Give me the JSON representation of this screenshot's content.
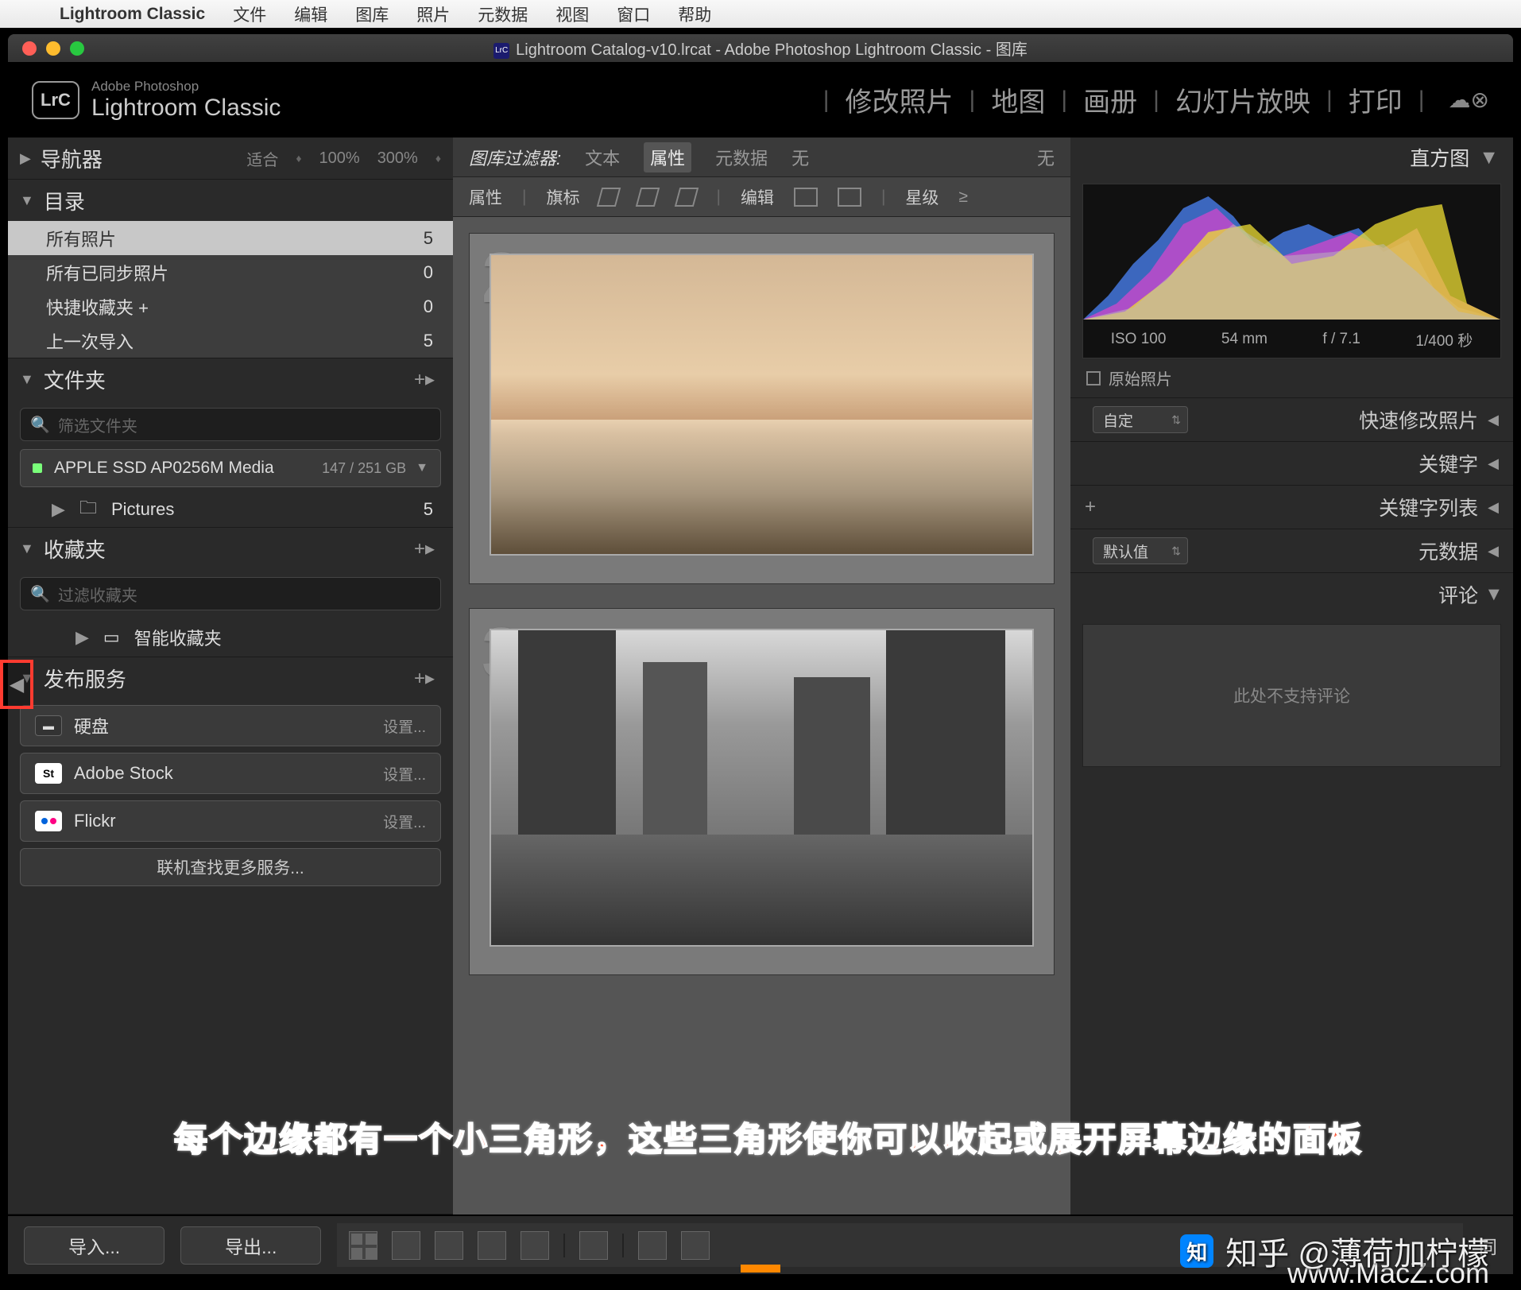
{
  "menubar": {
    "app": "Lightroom Classic",
    "items": [
      "文件",
      "编辑",
      "图库",
      "照片",
      "元数据",
      "视图",
      "窗口",
      "帮助"
    ]
  },
  "window": {
    "title": "Lightroom Catalog-v10.lrcat - Adobe Photoshop Lightroom Classic - 图库"
  },
  "header": {
    "brand_small": "Adobe Photoshop",
    "brand_big": "Lightroom Classic",
    "badge": "LrC",
    "modules": [
      "修改照片",
      "地图",
      "画册",
      "幻灯片放映",
      "打印"
    ]
  },
  "navigator": {
    "title": "导航器",
    "fit": "适合",
    "z100": "100%",
    "z300": "300%"
  },
  "catalog": {
    "title": "目录",
    "items": [
      {
        "label": "所有照片",
        "count": "5",
        "selected": true
      },
      {
        "label": "所有已同步照片",
        "count": "0"
      },
      {
        "label": "快捷收藏夹 +",
        "count": "0"
      },
      {
        "label": "上一次导入",
        "count": "5"
      }
    ]
  },
  "folders": {
    "title": "文件夹",
    "search_placeholder": "筛选文件夹",
    "volume": "APPLE SSD AP0256M Media",
    "capacity": "147 / 251 GB",
    "folder_name": "Pictures",
    "folder_count": "5"
  },
  "collections": {
    "title": "收藏夹",
    "search_placeholder": "过滤收藏夹",
    "smart": "智能收藏夹"
  },
  "publish": {
    "title": "发布服务",
    "items": [
      {
        "label": "硬盘",
        "setup": "设置..."
      },
      {
        "label": "Adobe Stock",
        "setup": "设置..."
      },
      {
        "label": "Flickr",
        "setup": "设置..."
      }
    ],
    "more": "联机查找更多服务..."
  },
  "filter": {
    "label": "图库过滤器:",
    "text": "文本",
    "attr": "属性",
    "meta": "元数据",
    "none": "无",
    "none2": "无"
  },
  "attr_bar": {
    "attr": "属性",
    "flag": "旗标",
    "edit": "编辑",
    "rating": "星级"
  },
  "thumbs": {
    "idx2": "2",
    "idx3": "3"
  },
  "right": {
    "histogram": "直方图",
    "iso": "ISO 100",
    "focal": "54 mm",
    "aperture": "f / 7.1",
    "shutter": "1/400 秒",
    "original": "原始照片",
    "quick_dev": "快速修改照片",
    "quick_preset": "自定",
    "keywords": "关键字",
    "keyword_list": "关键字列表",
    "metadata": "元数据",
    "meta_preset": "默认值",
    "comments": "评论",
    "comments_empty": "此处不支持评论"
  },
  "bottom": {
    "import": "导入...",
    "export": "导出...",
    "sync": "同"
  },
  "annotation": "每个边缘都有一个小三角形，这些三角形使你可以收起或展开屏幕边缘的面板",
  "watermark": {
    "zhihu": "知乎 @薄荷加柠檬",
    "url": "www.MacZ.com"
  }
}
